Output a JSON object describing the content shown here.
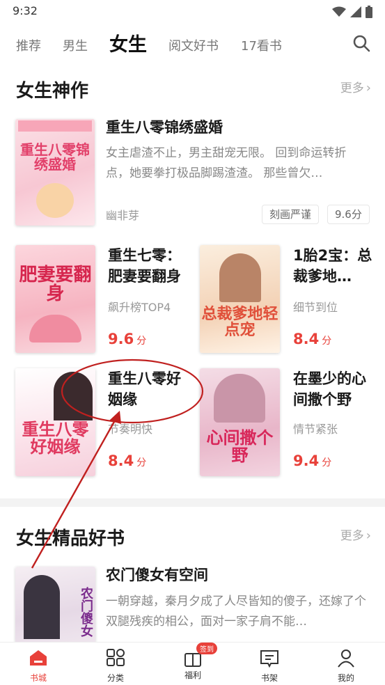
{
  "status": {
    "time": "9:32"
  },
  "tabs": [
    {
      "label": "推荐"
    },
    {
      "label": "男生"
    },
    {
      "label": "女生"
    },
    {
      "label": "阅文好书"
    },
    {
      "label": "17看书"
    }
  ],
  "section1": {
    "title": "女生神作",
    "more": "更多",
    "featured": {
      "title": "重生八零锦绣盛婚",
      "desc": "女主虐渣不止，男主甜宠无限。 回到命运转折点，她要拳打极品脚踢渣渣。 那些曾欠…",
      "author": "幽非芽",
      "tags": [
        "刻画严谨",
        "9.6分"
      ],
      "cover_text": "重生八零锦绣盛婚"
    },
    "grid": [
      {
        "title": "重生七零：肥妻要翻身",
        "sub": "飙升榜TOP4",
        "score": "9.6",
        "unit": "分",
        "cover_text": "肥妻要翻身"
      },
      {
        "title": "1胎2宝：总裁爹地…",
        "sub": "细节到位",
        "score": "8.4",
        "unit": "分",
        "cover_text": "总裁爹地轻点宠"
      },
      {
        "title": "重生八零好姻缘",
        "sub": "节奏明快",
        "score": "8.4",
        "unit": "分",
        "cover_text": "重生八零好姻缘"
      },
      {
        "title": "在墨少的心间撒个野",
        "sub": "情节紧张",
        "score": "9.4",
        "unit": "分",
        "cover_text": "心间撒个野"
      }
    ]
  },
  "section2": {
    "title": "女生精品好书",
    "more": "更多",
    "featured": {
      "title": "农门傻女有空间",
      "desc": "一朝穿越，秦月夕成了人尽皆知的傻子，还嫁了个双腿残疾的相公，面对一家子肩不能…",
      "cover_text": "农门傻女"
    }
  },
  "bottom_nav": [
    {
      "label": "书城"
    },
    {
      "label": "分类"
    },
    {
      "label": "福利",
      "badge": "签到"
    },
    {
      "label": "书架"
    },
    {
      "label": "我的"
    }
  ],
  "colors": {
    "accent": "#e8413a",
    "annotation": "#c0201f"
  }
}
